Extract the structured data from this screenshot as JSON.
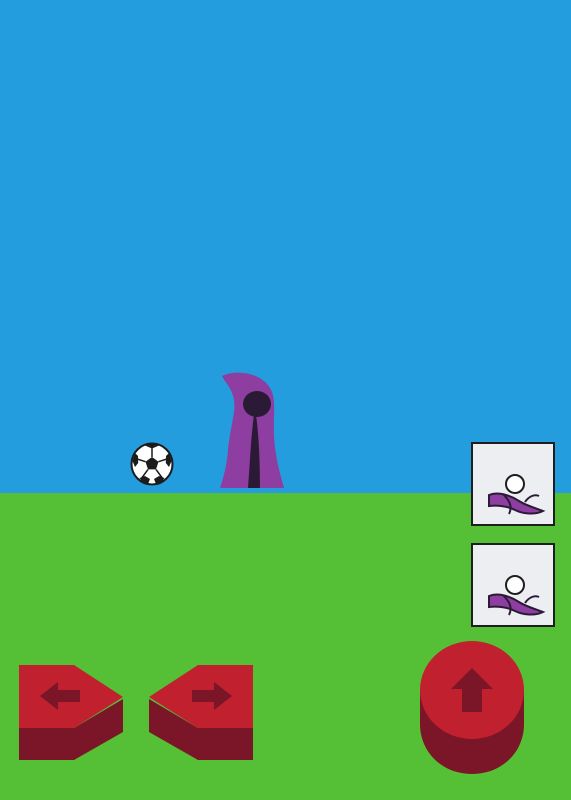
{
  "scene": {
    "sky_color": "#239ddd",
    "ground_color": "#55bf36"
  },
  "player": {
    "icon": "hooded-figure-icon",
    "robe_color": "#8d3ea0",
    "face_color": "#2b1a36"
  },
  "ball": {
    "icon": "soccer-ball-icon"
  },
  "abilities": [
    {
      "icon": "kick-ability-icon"
    },
    {
      "icon": "kick-ability-icon"
    }
  ],
  "controls": {
    "accent": "#c1202f",
    "shadow": "#7a1628",
    "left": {
      "icon": "arrow-left-icon"
    },
    "right": {
      "icon": "arrow-right-icon"
    },
    "jump": {
      "icon": "arrow-up-icon"
    }
  }
}
